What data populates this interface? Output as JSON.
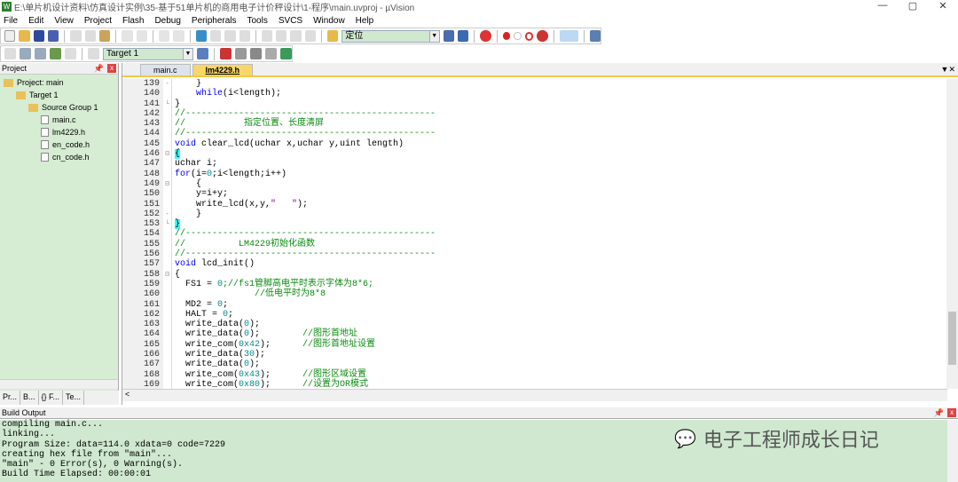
{
  "window": {
    "title": "E:\\单片机设计资料\\仿真设计实例\\35-基于51单片机的商用电子计价秤设计\\1-程序\\main.uvproj - µVision",
    "app_icon": "W",
    "minimize": "—",
    "maximize": "▢",
    "close": "✕"
  },
  "menu": [
    "File",
    "Edit",
    "View",
    "Project",
    "Flash",
    "Debug",
    "Peripherals",
    "Tools",
    "SVCS",
    "Window",
    "Help"
  ],
  "toolbar": {
    "find_combo": "定位",
    "target_combo": "Target 1"
  },
  "project": {
    "title": "Project",
    "tree": [
      {
        "label": "Project: main",
        "type": "proj",
        "indent": 0
      },
      {
        "label": "Target 1",
        "type": "folder",
        "indent": 1
      },
      {
        "label": "Source Group 1",
        "type": "folder",
        "indent": 2
      },
      {
        "label": "main.c",
        "type": "file",
        "indent": 3
      },
      {
        "label": "lm4229.h",
        "type": "file",
        "indent": 3
      },
      {
        "label": "en_code.h",
        "type": "file",
        "indent": 3
      },
      {
        "label": "cn_code.h",
        "type": "file",
        "indent": 3
      }
    ],
    "tabs": [
      "Pr...",
      "B...",
      "{} F...",
      "Te..."
    ]
  },
  "editor": {
    "tabs": [
      {
        "label": "main.c",
        "active": false
      },
      {
        "label": "lm4229.h",
        "active": true
      }
    ],
    "lines": [
      {
        "n": "139",
        "f": "-",
        "s": [
          [
            "    }",
            ""
          ]
        ]
      },
      {
        "n": "140",
        "f": "",
        "s": [
          [
            "    ",
            ""
          ],
          [
            "while",
            "kw"
          ],
          [
            "(i<length);",
            ""
          ]
        ]
      },
      {
        "n": "141",
        "f": "└",
        "s": [
          [
            "}",
            ""
          ]
        ]
      },
      {
        "n": "142",
        "f": "",
        "s": [
          [
            "//-----------------------------------------------",
            "cm"
          ]
        ]
      },
      {
        "n": "143",
        "f": "",
        "s": [
          [
            "//           指定位置、长度清屏",
            "cm"
          ]
        ]
      },
      {
        "n": "144",
        "f": "",
        "s": [
          [
            "//-----------------------------------------------",
            "cm"
          ]
        ]
      },
      {
        "n": "145",
        "f": "",
        "s": [
          [
            "void",
            "kw"
          ],
          [
            " clear_lcd(uchar x,uchar y,uint length)",
            ""
          ]
        ]
      },
      {
        "n": "146",
        "f": "⊟",
        "s": [
          [
            "{",
            "br"
          ]
        ]
      },
      {
        "n": "147",
        "f": "",
        "s": [
          [
            "uchar i;",
            ""
          ]
        ]
      },
      {
        "n": "148",
        "f": "",
        "s": [
          [
            "for",
            "kw"
          ],
          [
            "(i=",
            ""
          ],
          [
            "0",
            "nu"
          ],
          [
            ";i<length;i++)",
            ""
          ]
        ]
      },
      {
        "n": "149",
        "f": "⊟",
        "s": [
          [
            "    {",
            ""
          ]
        ]
      },
      {
        "n": "150",
        "f": "",
        "s": [
          [
            "    y=i+y;",
            ""
          ]
        ]
      },
      {
        "n": "151",
        "f": "",
        "s": [
          [
            "    write_lcd(x,y,",
            ""
          ],
          [
            "\"   \"",
            "st"
          ],
          [
            ");",
            ""
          ]
        ]
      },
      {
        "n": "152",
        "f": "-",
        "s": [
          [
            "    }",
            ""
          ]
        ]
      },
      {
        "n": "153",
        "f": "└",
        "s": [
          [
            "}",
            "br"
          ]
        ]
      },
      {
        "n": "154",
        "f": "",
        "s": [
          [
            "//-----------------------------------------------",
            "cm"
          ]
        ]
      },
      {
        "n": "155",
        "f": "",
        "s": [
          [
            "//          LM4229初始化函数",
            "cm"
          ]
        ]
      },
      {
        "n": "156",
        "f": "",
        "s": [
          [
            "//-----------------------------------------------",
            "cm"
          ]
        ]
      },
      {
        "n": "157",
        "f": "",
        "s": [
          [
            "void",
            "kw"
          ],
          [
            " lcd_init()",
            ""
          ]
        ]
      },
      {
        "n": "158",
        "f": "⊟",
        "s": [
          [
            "{",
            ""
          ]
        ]
      },
      {
        "n": "159",
        "f": "",
        "s": [
          [
            "  FS1 = ",
            ""
          ],
          [
            "0",
            "nu"
          ],
          [
            ";//fs1管脚高电平时表示字体为8*6;",
            "cm"
          ]
        ]
      },
      {
        "n": "160",
        "f": "",
        "s": [
          [
            "               //低电平时为8*8",
            "cm"
          ]
        ]
      },
      {
        "n": "161",
        "f": "",
        "s": [
          [
            "  MD2 = ",
            ""
          ],
          [
            "0",
            "nu"
          ],
          [
            ";",
            ""
          ]
        ]
      },
      {
        "n": "162",
        "f": "",
        "s": [
          [
            "  HALT = ",
            ""
          ],
          [
            "0",
            "nu"
          ],
          [
            ";",
            ""
          ]
        ]
      },
      {
        "n": "163",
        "f": "",
        "s": [
          [
            "  write_data(",
            ""
          ],
          [
            "0",
            "nu"
          ],
          [
            ");",
            ""
          ]
        ]
      },
      {
        "n": "164",
        "f": "",
        "s": [
          [
            "  write_data(",
            ""
          ],
          [
            "0",
            "nu"
          ],
          [
            ");        ",
            ""
          ],
          [
            "//图形首地址",
            "cm"
          ]
        ]
      },
      {
        "n": "165",
        "f": "",
        "s": [
          [
            "  write_com(",
            ""
          ],
          [
            "0x42",
            "nu"
          ],
          [
            ");      ",
            ""
          ],
          [
            "//图形首地址设置",
            "cm"
          ]
        ]
      },
      {
        "n": "166",
        "f": "",
        "s": [
          [
            "  write_data(",
            ""
          ],
          [
            "30",
            "nu"
          ],
          [
            ");",
            ""
          ]
        ]
      },
      {
        "n": "167",
        "f": "",
        "s": [
          [
            "  write_data(",
            ""
          ],
          [
            "0",
            "nu"
          ],
          [
            ");",
            ""
          ]
        ]
      },
      {
        "n": "168",
        "f": "",
        "s": [
          [
            "  write_com(",
            ""
          ],
          [
            "0x43",
            "nu"
          ],
          [
            ");      ",
            ""
          ],
          [
            "//图形区域设置",
            "cm"
          ]
        ]
      },
      {
        "n": "169",
        "f": "",
        "s": [
          [
            "  write_com(",
            ""
          ],
          [
            "0x80",
            "nu"
          ],
          [
            ");      ",
            ""
          ],
          [
            "//设置为OR模式",
            "cm"
          ]
        ]
      }
    ]
  },
  "build": {
    "title": "Build Output",
    "lines": [
      "compiling main.c...",
      "linking...",
      "Program Size: data=114.0 xdata=0 code=7229",
      "creating hex file from \"main\"...",
      "\"main\" - 0 Error(s), 0 Warning(s).",
      "Build Time Elapsed:  00:00:01"
    ]
  },
  "watermark": "电子工程师成长日记"
}
